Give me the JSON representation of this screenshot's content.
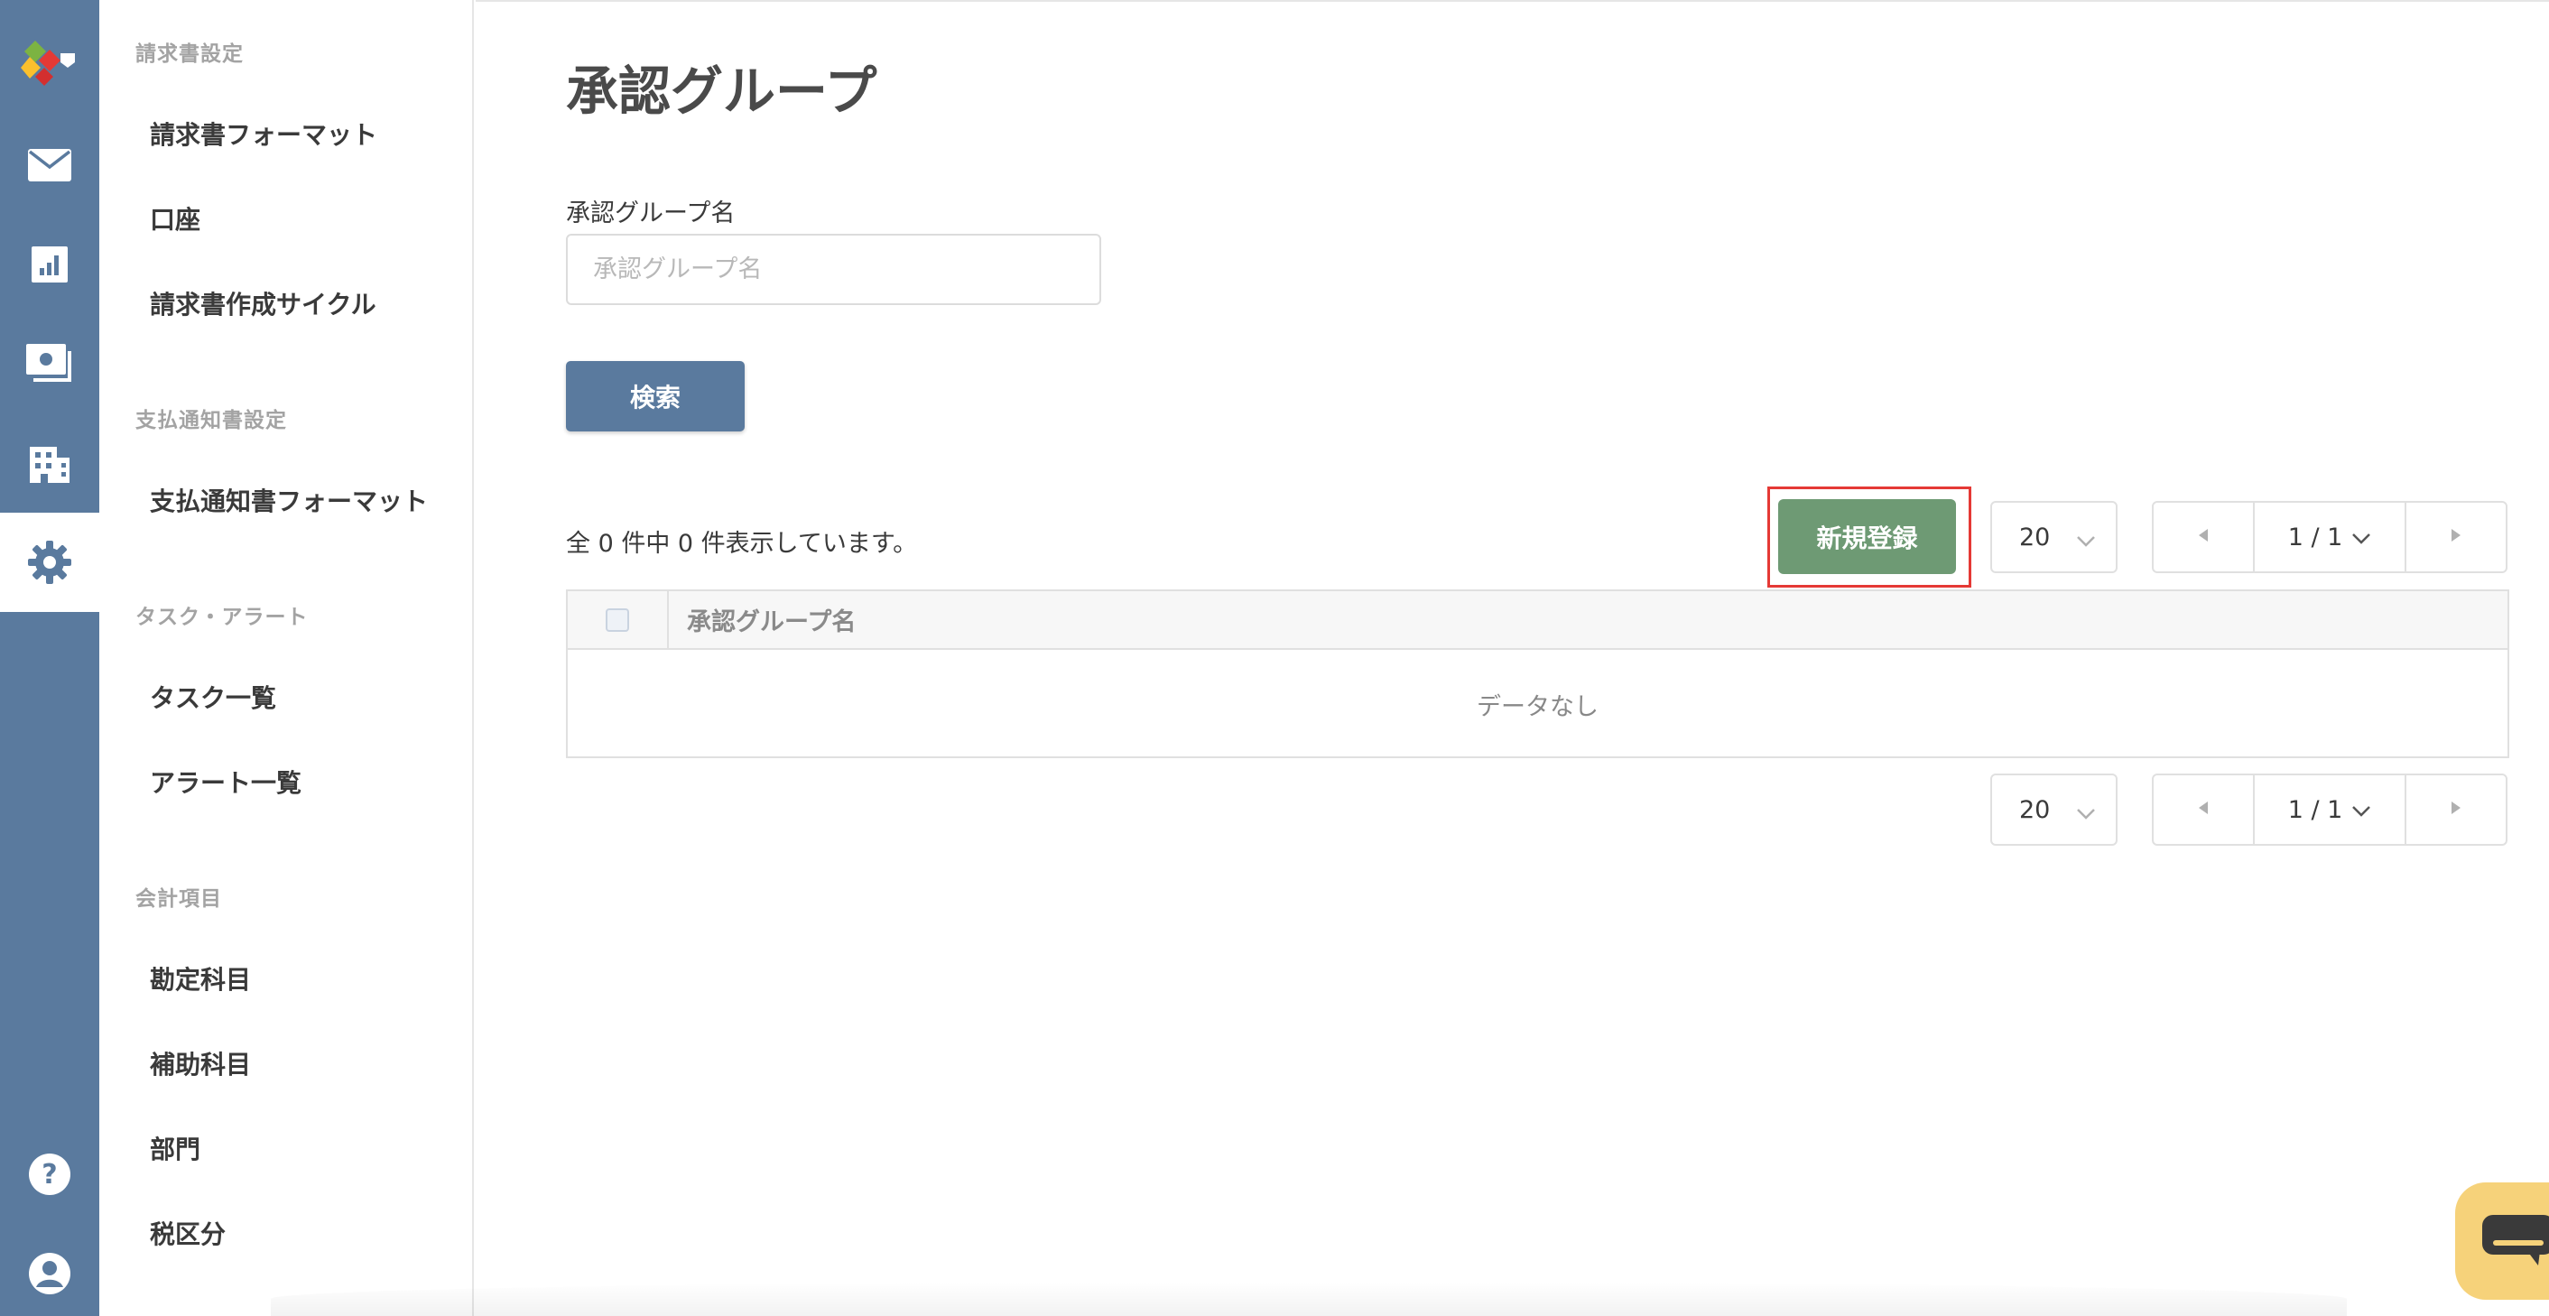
{
  "colors": {
    "rail_bg": "#5a7a9e",
    "primary_button": "#5a7a9e",
    "new_button": "#6e9a74",
    "highlight": "#e53935",
    "chat_widget": "#f6d27a"
  },
  "rail": {
    "icons": [
      "app-logo-icon",
      "mail-icon",
      "report-chart-icon",
      "invoice-icon",
      "building-icon",
      "gear-icon",
      "help-icon",
      "account-icon"
    ],
    "active": "gear-icon"
  },
  "sidebar": {
    "sections": [
      {
        "title": "請求書設定",
        "items": [
          "請求書フォーマット",
          "口座",
          "請求書作成サイクル"
        ]
      },
      {
        "title": "支払通知書設定",
        "items": [
          "支払通知書フォーマット"
        ]
      },
      {
        "title": "タスク・アラート",
        "items": [
          "タスク一覧",
          "アラート一覧"
        ]
      },
      {
        "title": "会計項目",
        "items": [
          "勘定科目",
          "補助科目",
          "部門",
          "税区分"
        ]
      }
    ]
  },
  "main": {
    "title": "承認グループ",
    "search": {
      "label": "承認グループ名",
      "placeholder": "承認グループ名",
      "value": "",
      "button_label": "検索"
    },
    "result_count": "全 0 件中 0 件表示しています。",
    "new_button_label": "新規登録",
    "pagination": {
      "per_page": "20",
      "page_display": "1 / 1"
    },
    "table": {
      "columns": [
        "承認グループ名"
      ],
      "rows": [],
      "empty_text": "データなし"
    }
  }
}
